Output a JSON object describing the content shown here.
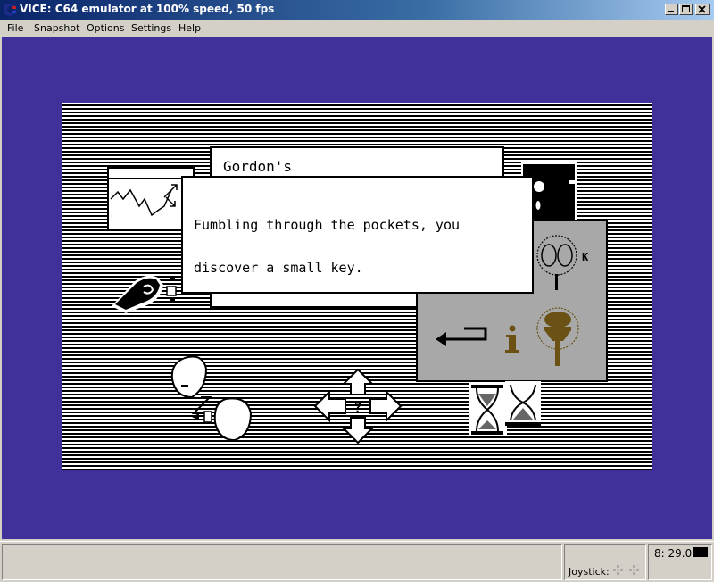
{
  "window": {
    "title": "VICE: C64 emulator at 100% speed, 50 fps",
    "controls": [
      "minimize",
      "maximize",
      "close"
    ]
  },
  "menubar": {
    "items": [
      {
        "label": "File"
      },
      {
        "label": "Snapshot"
      },
      {
        "label": "Options"
      },
      {
        "label": "Settings"
      },
      {
        "label": "Help"
      }
    ]
  },
  "game": {
    "location_window_title": "Gordon's",
    "message_line1": "Fumbling through the pockets, you",
    "message_line2": "discover a small key.",
    "panel_icons": [
      "look-icon",
      "back-arrow-icon",
      "info-icon",
      "use-icon"
    ],
    "look_key_hint": "K",
    "icons": [
      "hand-grab-icon",
      "talk-icon",
      "move-arrows-icon",
      "hourglass-icon",
      "graph-window-icon",
      "door-icon"
    ],
    "colors": {
      "border": "#40319a",
      "panel": "#a8a8a8",
      "accent_brown": "#6b5214"
    }
  },
  "statusbar": {
    "joystick_label": "Joystick:",
    "drive_status": "8: 29.0"
  }
}
